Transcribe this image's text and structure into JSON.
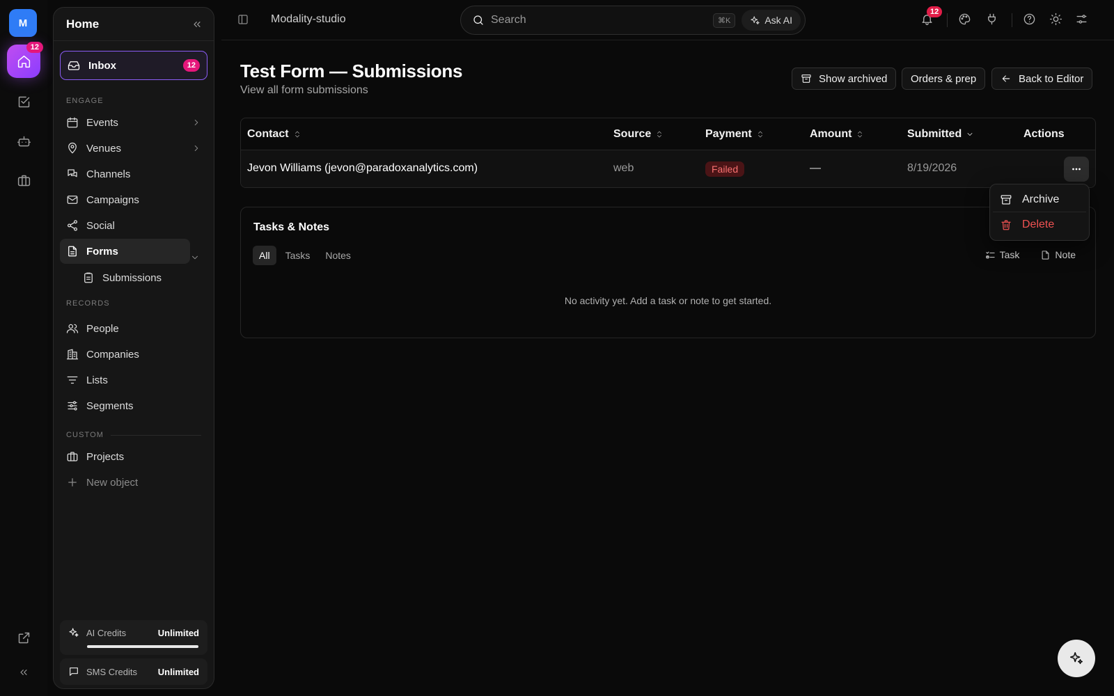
{
  "rail": {
    "workspace_initial": "M",
    "home_badge": "12"
  },
  "sidebar": {
    "title": "Home",
    "inbox": {
      "label": "Inbox",
      "count": "12"
    },
    "sections": {
      "engage": "ENGAGE",
      "records": "RECORDS",
      "custom": "CUSTOM"
    },
    "items": {
      "events": "Events",
      "venues": "Venues",
      "channels": "Channels",
      "campaigns": "Campaigns",
      "social": "Social",
      "forms": "Forms",
      "submissions": "Submissions",
      "people": "People",
      "companies": "Companies",
      "lists": "Lists",
      "segments": "Segments",
      "projects": "Projects",
      "new_object": "New object"
    },
    "credits": {
      "ai_label": "AI Credits",
      "ai_value": "Unlimited",
      "ai_level": 1.0,
      "sms_label": "SMS Credits",
      "sms_value": "Unlimited"
    }
  },
  "topbar": {
    "workspace": "Modality-studio",
    "search_placeholder": "Search",
    "shortcut": "⌘K",
    "ask_ai": "Ask AI",
    "notifications_count": "12"
  },
  "page": {
    "title": "Test Form — Submissions",
    "subtitle": "View all form submissions",
    "buttons": {
      "show_archived": "Show archived",
      "orders_prep": "Orders & prep",
      "back_editor": "Back to Editor"
    }
  },
  "table": {
    "columns": [
      "Contact",
      "Source",
      "Payment",
      "Amount",
      "Submitted",
      "Actions"
    ],
    "rows": [
      {
        "contact": "Jevon Williams (jevon@paradoxanalytics.com)",
        "source": "web",
        "payment": "Failed",
        "amount": "—",
        "submitted": "8/19/2026"
      }
    ]
  },
  "row_menu": {
    "archive": "Archive",
    "delete": "Delete"
  },
  "notes": {
    "title": "Tasks & Notes",
    "tabs": [
      "All",
      "Tasks",
      "Notes"
    ],
    "add_task": "Task",
    "add_note": "Note",
    "empty": "No activity yet. Add a task or note to get started."
  },
  "colors": {
    "accent": "#8b5cf6",
    "badge": "#e5177b",
    "danger": "#f05252",
    "workspace": "#2f7cf6"
  }
}
